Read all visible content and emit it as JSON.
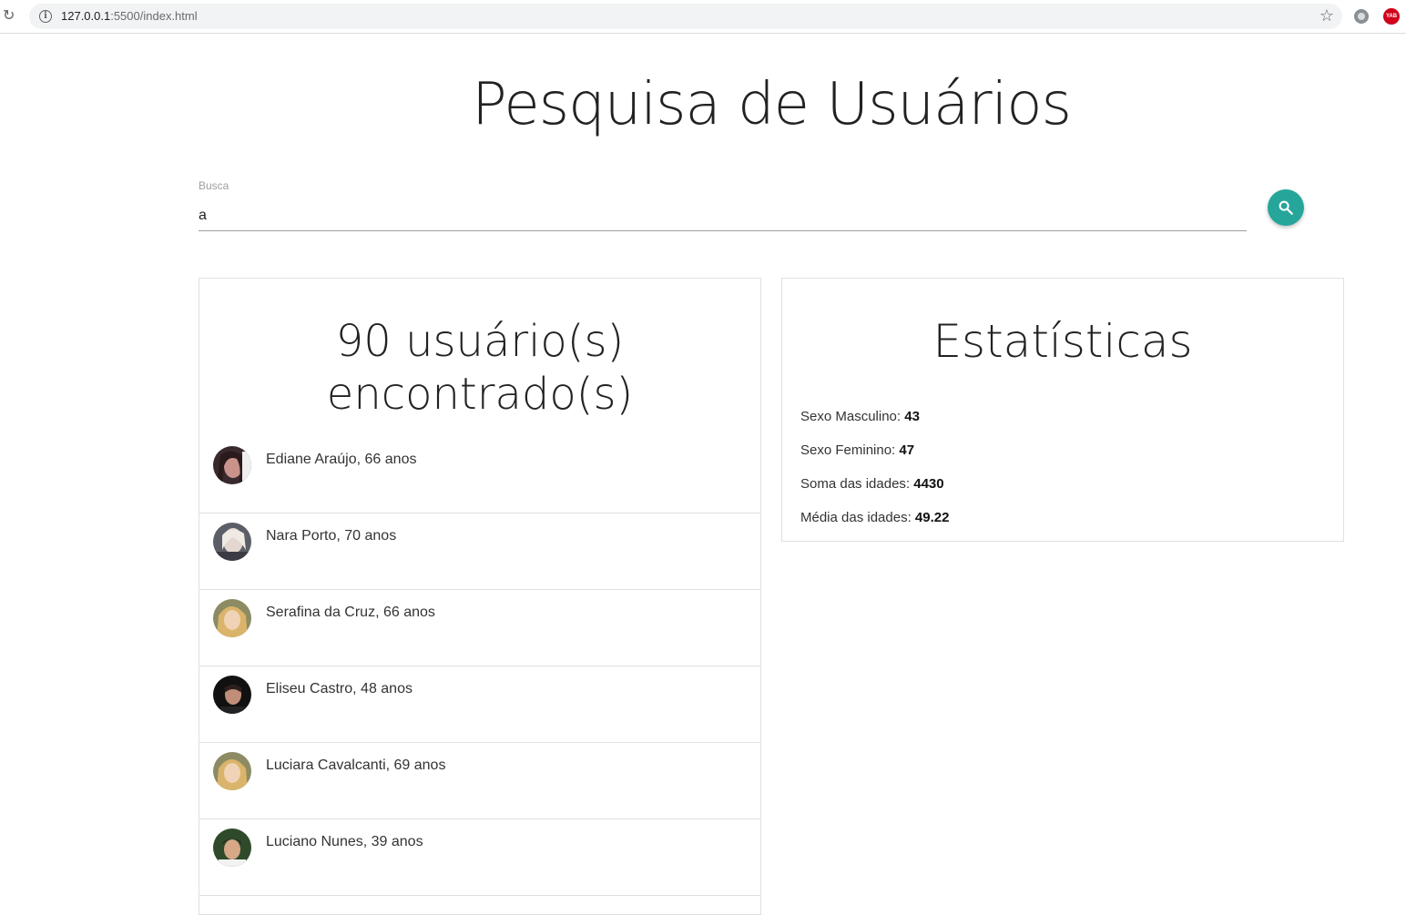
{
  "browser": {
    "url_host": "127.0.0.1",
    "url_path": ":5500/index.html",
    "ext2_label": "YAB"
  },
  "page": {
    "title": "Pesquisa de Usuários"
  },
  "search": {
    "label": "Busca",
    "value": "a"
  },
  "users": {
    "title_line1": "90 usuário(s)",
    "title_line2": "encontrado(s)",
    "items": [
      {
        "label": "Ediane Araújo, 66 anos"
      },
      {
        "label": "Nara Porto, 70 anos"
      },
      {
        "label": "Serafina da Cruz, 66 anos"
      },
      {
        "label": "Eliseu Castro, 48 anos"
      },
      {
        "label": "Luciara Cavalcanti, 69 anos"
      },
      {
        "label": "Luciano Nunes, 39 anos"
      }
    ]
  },
  "stats": {
    "title": "Estatísticas",
    "male_label": "Sexo Masculino: ",
    "male_value": "43",
    "female_label": "Sexo Feminino: ",
    "female_value": "47",
    "sum_label": "Soma das idades: ",
    "sum_value": "4430",
    "avg_label": "Média das idades: ",
    "avg_value": "49.22"
  },
  "colors": {
    "accent": "#26a69a"
  }
}
